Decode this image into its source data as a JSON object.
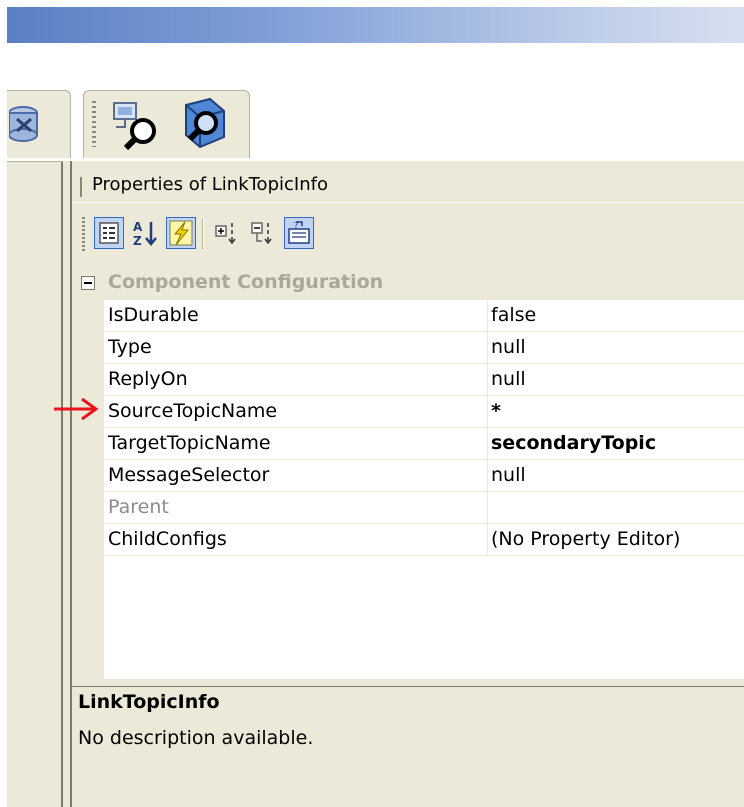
{
  "window": {
    "titlebar_colors": [
      "#5a7fc4",
      "#d7e0f0"
    ]
  },
  "toolbar": {
    "left_icon": "database-icon",
    "right_icons": [
      "network-search-icon",
      "search-object-icon"
    ]
  },
  "properties": {
    "header_title": "Properties of LinkTopicInfo",
    "toolbar_buttons": [
      {
        "icon": "categorized-icon",
        "checked": true
      },
      {
        "icon": "alphabetical-sort-icon",
        "checked": false
      },
      {
        "icon": "events-lightning-icon",
        "checked": true
      },
      {
        "icon": "expand-all-icon",
        "checked": false
      },
      {
        "icon": "collapse-all-icon",
        "checked": false
      },
      {
        "icon": "property-pages-icon",
        "checked": false
      }
    ],
    "category": "Component Configuration",
    "rows": [
      {
        "name": "IsDurable",
        "value": "false"
      },
      {
        "name": "Type",
        "value": "null"
      },
      {
        "name": "ReplyOn",
        "value": "null"
      },
      {
        "name": "SourceTopicName",
        "value": "*"
      },
      {
        "name": "TargetTopicName",
        "value": "secondaryTopic"
      },
      {
        "name": "MessageSelector",
        "value": "null"
      },
      {
        "name": "Parent",
        "value": ""
      },
      {
        "name": "ChildConfigs",
        "value": "(No Property Editor)"
      }
    ],
    "description": {
      "title": "LinkTopicInfo",
      "text": "No description available."
    },
    "annotation_arrow_color": "#e8141c"
  }
}
